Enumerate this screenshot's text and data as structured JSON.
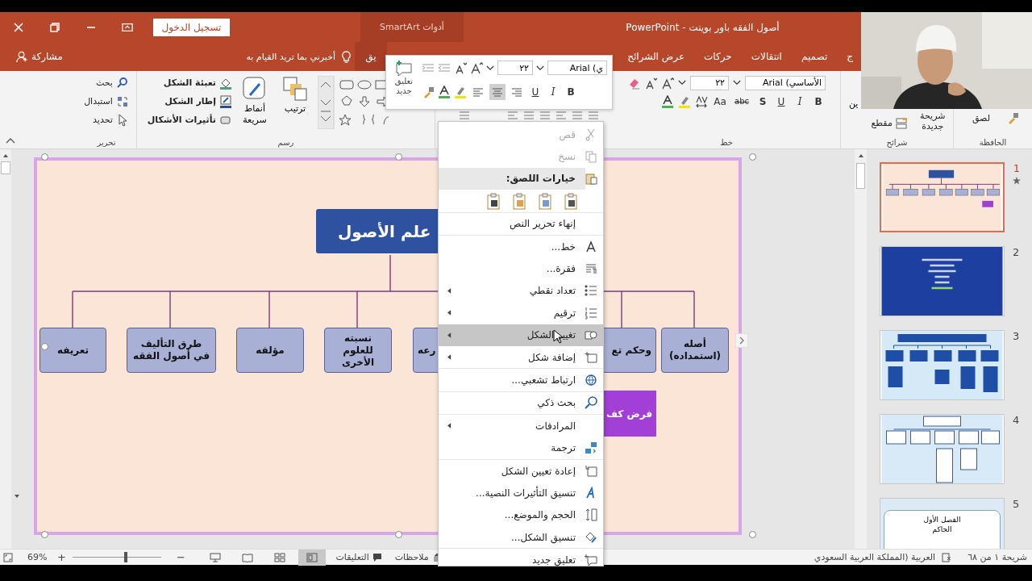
{
  "title_bar": {
    "title": "أصول الفقه باور بوينت  -  PowerPoint",
    "sign_in": "تسجيل الدخول",
    "context_group": "أدوات SmartArt"
  },
  "tab_row": {
    "share": "مشاركة",
    "tell_me": "أخبرني بما تريد القيام به",
    "tabs": [
      {
        "label": "ج",
        "kind": "normal",
        "selected": false
      },
      {
        "label": "تصميم",
        "kind": "normal",
        "selected": false
      },
      {
        "label": "انتقالات",
        "kind": "normal",
        "selected": false
      },
      {
        "label": "حركات",
        "kind": "normal",
        "selected": false
      },
      {
        "label": "عرض الشرائح",
        "kind": "normal",
        "selected": false
      },
      {
        "label": "يق",
        "kind": "contextual",
        "selected": false
      }
    ]
  },
  "ribbon": {
    "clipboard": {
      "label": "الحافظة",
      "paste": "لصق"
    },
    "slides": {
      "label": "شرائح",
      "new_slide": "شريحة جديدة",
      "section": "مقطع",
      "reset": "ين"
    },
    "font": {
      "label": "خط",
      "font_name": "الأساسي) Arial",
      "font_size": "٢٢",
      "buttons": [
        "B",
        "I",
        "U",
        "S",
        "abc",
        "Aa"
      ]
    },
    "drawing": {
      "label": "رسم",
      "arrange": "ترتيب",
      "quick_styles": "أنماط سريعة",
      "fill": "تعبئة الشكل",
      "outline": "إطار الشكل",
      "effects": "تأثيرات الأشكال"
    },
    "editing": {
      "label": "تحرير",
      "find": "بحث",
      "replace": "استبدال",
      "select": "تحديد"
    }
  },
  "mini_toolbar": {
    "font_name": "ي) Arial",
    "font_size": "٢٢",
    "new_comment": "تعليق جديد",
    "buttons": [
      "B",
      "I",
      "U"
    ],
    "align": [
      {
        "kind": "right",
        "selected": false
      },
      {
        "kind": "center",
        "selected": true
      },
      {
        "kind": "left",
        "selected": false
      }
    ]
  },
  "context_menu": [
    {
      "kind": "item",
      "label": "قص",
      "disabled": true,
      "submenu": false,
      "selected": false,
      "divider": false
    },
    {
      "kind": "item",
      "label": "نسخ",
      "disabled": true,
      "submenu": false,
      "selected": false,
      "divider": false
    },
    {
      "kind": "header",
      "label": "خيارات اللصق:"
    },
    {
      "kind": "paste-options"
    },
    {
      "kind": "item",
      "label": "إنهاء تحرير النص",
      "disabled": false,
      "submenu": false,
      "selected": false,
      "divider": true
    },
    {
      "kind": "item",
      "label": "خط...",
      "disabled": false,
      "submenu": false,
      "selected": false,
      "divider": true
    },
    {
      "kind": "item",
      "label": "فقرة...",
      "disabled": false,
      "submenu": false,
      "selected": false,
      "divider": false
    },
    {
      "kind": "item",
      "label": "تعداد نقطي",
      "disabled": false,
      "submenu": true,
      "selected": false,
      "divider": false
    },
    {
      "kind": "item",
      "label": "ترقيم",
      "disabled": false,
      "submenu": true,
      "selected": false,
      "divider": false
    },
    {
      "kind": "item",
      "label": "تغيير الشكل",
      "disabled": false,
      "submenu": true,
      "selected": true,
      "divider": false
    },
    {
      "kind": "item",
      "label": "إضافة شكل",
      "disabled": false,
      "submenu": true,
      "selected": false,
      "divider": false
    },
    {
      "kind": "item",
      "label": "ارتباط تشعبي...",
      "disabled": false,
      "submenu": false,
      "selected": false,
      "divider": true
    },
    {
      "kind": "item",
      "label": "بحث ذكي",
      "disabled": false,
      "submenu": false,
      "selected": false,
      "divider": true
    },
    {
      "kind": "item",
      "label": "المرادفات",
      "disabled": false,
      "submenu": true,
      "selected": false,
      "divider": true
    },
    {
      "kind": "item",
      "label": "ترجمة",
      "disabled": false,
      "submenu": false,
      "selected": false,
      "divider": false
    },
    {
      "kind": "item",
      "label": "إعادة تعيين الشكل",
      "disabled": false,
      "submenu": false,
      "selected": false,
      "divider": true
    },
    {
      "kind": "item",
      "label": "تنسيق التأثيرات النصية...",
      "disabled": false,
      "submenu": false,
      "selected": false,
      "divider": false
    },
    {
      "kind": "item",
      "label": "الحجم والموضع...",
      "disabled": false,
      "submenu": false,
      "selected": false,
      "divider": false
    },
    {
      "kind": "item",
      "label": "تنسيق الشكل...",
      "disabled": false,
      "submenu": false,
      "selected": false,
      "divider": false
    },
    {
      "kind": "item",
      "label": "تعليق جديد",
      "disabled": false,
      "submenu": false,
      "selected": false,
      "divider": true
    }
  ],
  "slide": {
    "title": "علم الأصول",
    "nodes": [
      "أصله (استمداده)",
      "وحكم تع",
      "رعه",
      "نسبته للعلوم الأخرى",
      "مؤلفه",
      "طرق التأليف في أصول الفقه",
      "تعريفه"
    ],
    "callout": "فرض كف"
  },
  "thumbnails": [
    {
      "number": "1",
      "selected": true,
      "animated": true,
      "kind": "org-chart"
    },
    {
      "number": "2",
      "selected": false,
      "animated": false,
      "kind": "blue-text"
    },
    {
      "number": "3",
      "selected": false,
      "animated": false,
      "kind": "blue-diagram"
    },
    {
      "number": "4",
      "selected": false,
      "animated": false,
      "kind": "light-diagram"
    },
    {
      "number": "5",
      "selected": false,
      "animated": false,
      "kind": "title-card",
      "lines": [
        "الفصل الأول",
        "الحاكم"
      ]
    }
  ],
  "status_bar": {
    "slide_info": "شريحة ١ من ٦٨",
    "language": "العربية (المملكة العربية السعودي",
    "notes": "ملاحظات",
    "comments": "التعليقات",
    "zoom": "69%",
    "zoom_in": "+",
    "zoom_out": "−",
    "zoom_slider": {
      "level": 0.6
    },
    "views": [
      {
        "kind": "normal",
        "selected": true
      },
      {
        "kind": "sorter",
        "selected": false
      },
      {
        "kind": "reading",
        "selected": false
      },
      {
        "kind": "slideshow",
        "selected": false
      }
    ]
  }
}
